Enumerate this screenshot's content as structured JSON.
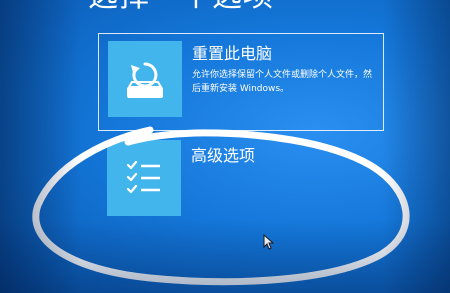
{
  "page": {
    "title": "选择一个选项"
  },
  "options": {
    "reset": {
      "title": "重置此电脑",
      "description": "允许你选择保留个人文件或删除个人文件，然后重新安装 Windows。",
      "icon": "reset-pc-icon"
    },
    "advanced": {
      "title": "高级选项",
      "icon": "checklist-icon"
    }
  },
  "colors": {
    "background": "#1477d9",
    "tile": "#42b6ec",
    "text": "#ffffff"
  }
}
